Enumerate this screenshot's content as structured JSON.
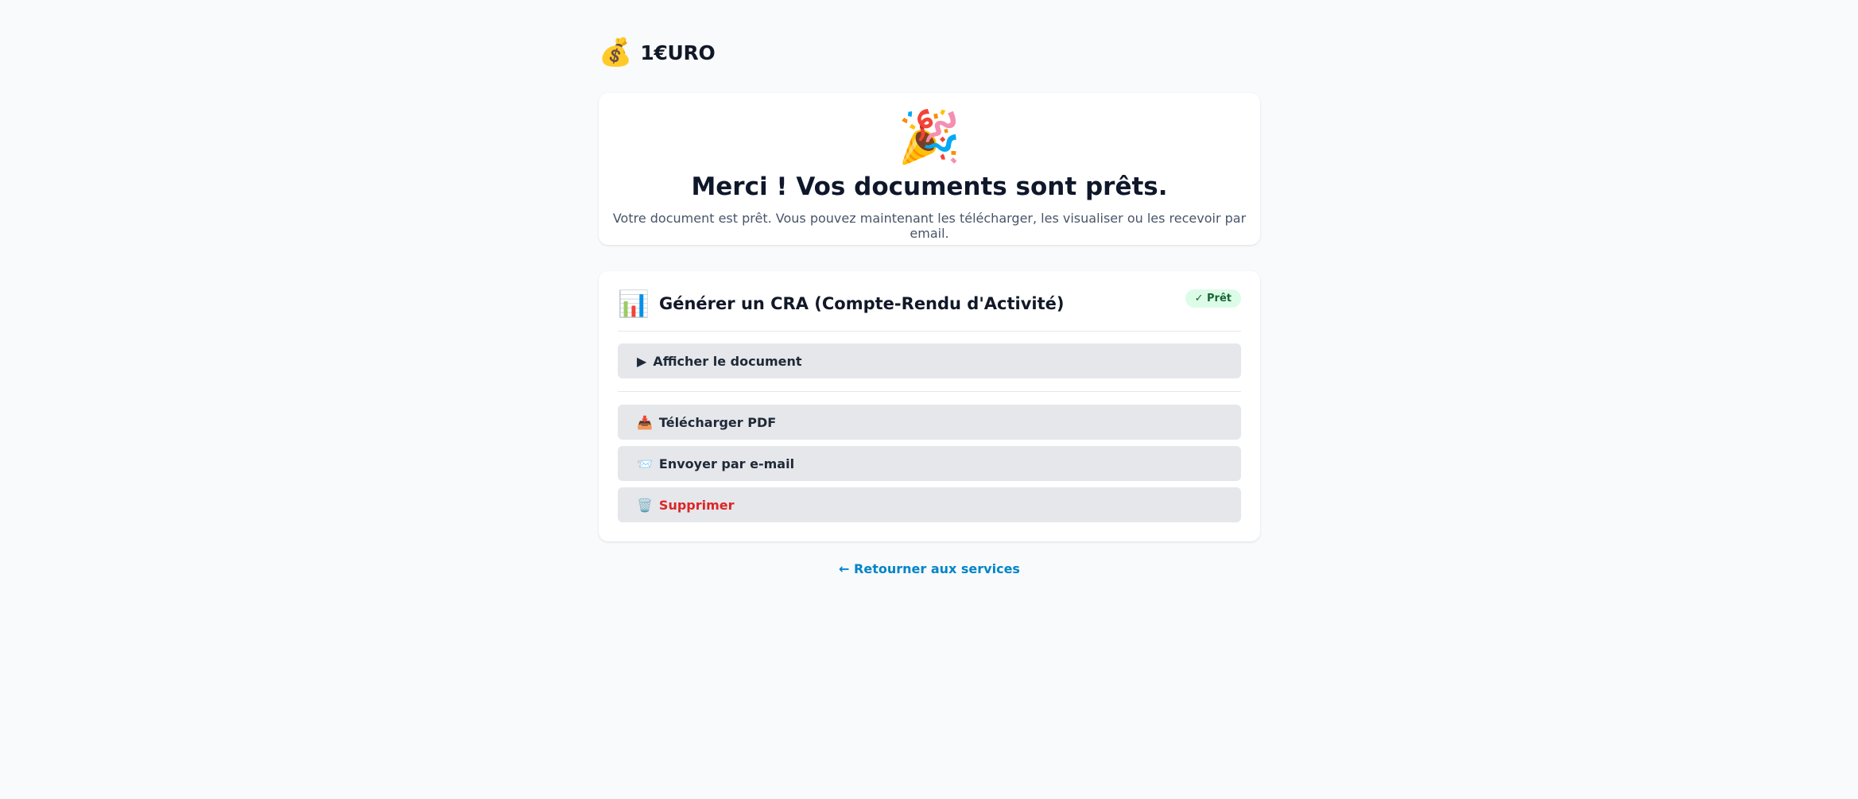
{
  "brand": {
    "icon": "💰",
    "name": "1€URO"
  },
  "hero": {
    "icon": "🎉",
    "title": "Merci ! Vos documents sont prêts.",
    "subtitle": "Votre document est prêt. Vous pouvez maintenant les télécharger, les visualiser ou les recevoir par email."
  },
  "document": {
    "icon": "📊",
    "title": "Générer un CRA (Compte-Rendu d'Activité)",
    "status_badge": "✓ Prêt",
    "status_color": "#166534",
    "view": {
      "icon": "▶",
      "label": "Afficher le document"
    },
    "actions": [
      {
        "icon": "📥",
        "label": "Télécharger PDF"
      },
      {
        "icon": "📨",
        "label": "Envoyer par e-mail"
      },
      {
        "icon": "🗑️",
        "label": "Supprimer",
        "color": "#dc2626"
      }
    ]
  },
  "back_link": "← Retourner aux services",
  "colors": {
    "page_bg": "#f8fafc",
    "button_bg": "#e5e7eb",
    "link": "#0284c7",
    "danger": "#dc2626"
  }
}
